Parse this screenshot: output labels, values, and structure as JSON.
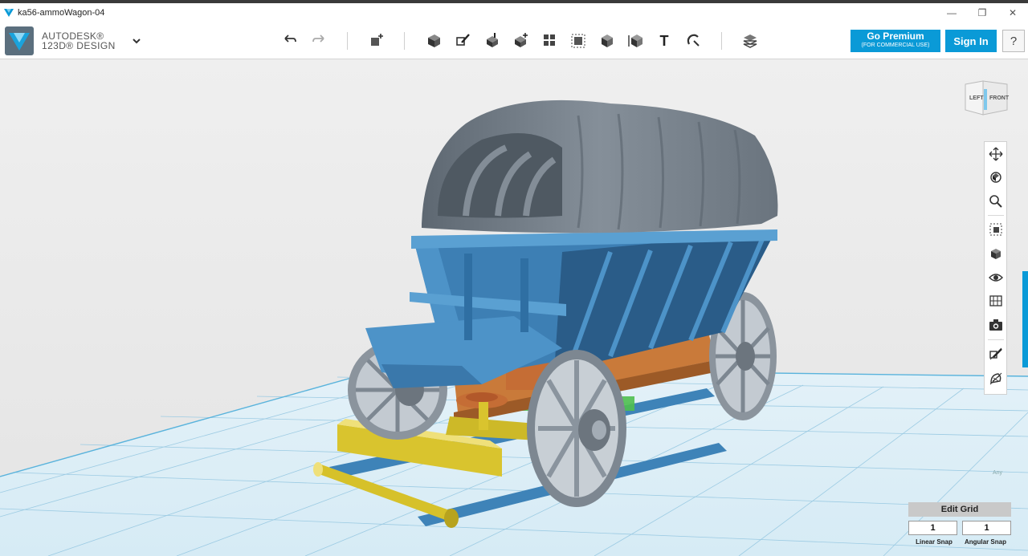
{
  "window": {
    "title": "ka56-ammoWagon-04",
    "minimize": "—",
    "restore": "❐",
    "close": "✕"
  },
  "brand": {
    "line1": "AUTODESK®",
    "line2": "123D® DESIGN"
  },
  "toolbar": {
    "tools": [
      {
        "name": "undo-icon"
      },
      {
        "name": "redo-icon"
      },
      {
        "name": "transform-icon"
      },
      {
        "name": "primitives-icon"
      },
      {
        "name": "sketch-icon"
      },
      {
        "name": "construct-icon"
      },
      {
        "name": "modify-icon"
      },
      {
        "name": "pattern-icon"
      },
      {
        "name": "group-icon"
      },
      {
        "name": "combine-icon"
      },
      {
        "name": "measure-icon"
      },
      {
        "name": "text-icon"
      },
      {
        "name": "snap-icon"
      },
      {
        "name": "materials-icon"
      }
    ],
    "text_tool_glyph": "T",
    "premium_label": "Go Premium",
    "premium_sub": "(FOR COMMERCIAL USE)",
    "signin_label": "Sign In",
    "help_label": "?"
  },
  "viewcube": {
    "left": "LEFT",
    "front": "FRONT"
  },
  "navbar": {
    "items": [
      "pan-icon",
      "orbit-icon",
      "zoom-icon",
      "fit-icon",
      "perspective-icon",
      "visibility-icon",
      "materials-outline-icon",
      "camera-icon",
      "hide-sketches-icon",
      "hide-meshes-icon"
    ]
  },
  "corner_label": "Any",
  "edit_grid": {
    "title": "Edit Grid",
    "linear_value": "1",
    "angular_value": "1",
    "linear_label": "Linear Snap",
    "angular_label": "Angular Snap"
  },
  "colors": {
    "accent": "#0a9ad7",
    "body_blue": "#4a8bbf",
    "canopy_gray": "#707a84",
    "chassis_orange": "#c97a3a",
    "shaft_yellow": "#d9c42e",
    "wheel_gray": "#9aa3ac"
  }
}
